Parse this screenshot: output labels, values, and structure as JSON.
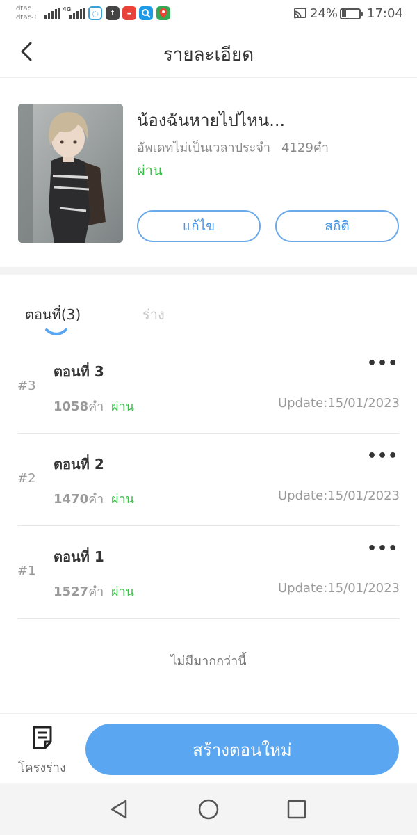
{
  "status_bar": {
    "carrier_1": "dtac",
    "carrier_2": "dtac-T",
    "network": "4G",
    "battery": "24%",
    "battery_level": 0.24,
    "time": "17:04",
    "icons": [
      "signal-icon",
      "cellular-4g-icon",
      "chat-app-icon",
      "facebook-icon",
      "shopping-app-icon",
      "search-app-icon",
      "maps-icon",
      "cast-icon",
      "battery-icon"
    ]
  },
  "header": {
    "title": "รายละเอียด",
    "back_icon": "chevron-left-icon"
  },
  "book": {
    "title": "น้องฉันหายไปไหน...",
    "schedule": "อัพเดทไม่เป็นเวลาประจำ",
    "word_count": "4129คำ",
    "status": "ผ่าน",
    "edit_label": "แก้ไข",
    "stats_label": "สถิติ"
  },
  "tabs": [
    {
      "label": "ตอนที่(3)",
      "active": true
    },
    {
      "label": "ร่าง",
      "active": false
    }
  ],
  "episodes": [
    {
      "num": "#3",
      "title": "ตอนที่ 3",
      "words_num": "1058",
      "words_unit": "คำ",
      "status": "ผ่าน",
      "update": "Update:15/01/2023"
    },
    {
      "num": "#2",
      "title": "ตอนที่ 2",
      "words_num": "1470",
      "words_unit": "คำ",
      "status": "ผ่าน",
      "update": "Update:15/01/2023"
    },
    {
      "num": "#1",
      "title": "ตอนที่ 1",
      "words_num": "1527",
      "words_unit": "คำ",
      "status": "ผ่าน",
      "update": "Update:15/01/2023"
    }
  ],
  "list_footer": "ไม่มีมากกว่านี้",
  "bottom": {
    "drafts_label": "โครงร่าง",
    "create_label": "สร้างตอนใหม่"
  },
  "colors": {
    "accent_blue": "#5aa6f0",
    "status_green": "#3bbf4a",
    "outline_blue": "#6aa9ea"
  }
}
